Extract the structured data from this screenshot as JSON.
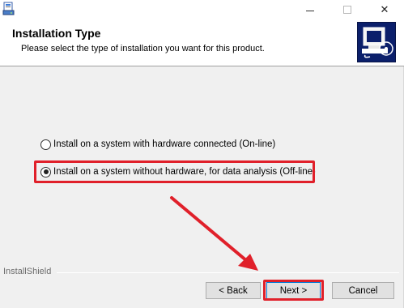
{
  "titlebar": {
    "minimize_icon": "minimize-icon",
    "maximize_icon": "maximize-icon",
    "close_glyph": "✕"
  },
  "header": {
    "title": "Installation Type",
    "subtitle": "Please select the type of installation you want for this product.",
    "logo_color": "#0b1f6b"
  },
  "options": [
    {
      "label": "Install on a system with hardware connected (On-line)",
      "selected": false
    },
    {
      "label": "Install on a system without hardware, for data analysis (Off-line)",
      "selected": true
    }
  ],
  "footer": {
    "brand": "InstallShield",
    "back_label": "< Back",
    "next_label": "Next >",
    "cancel_label": "Cancel"
  },
  "annotations": {
    "highlight_color": "#e0202a"
  }
}
